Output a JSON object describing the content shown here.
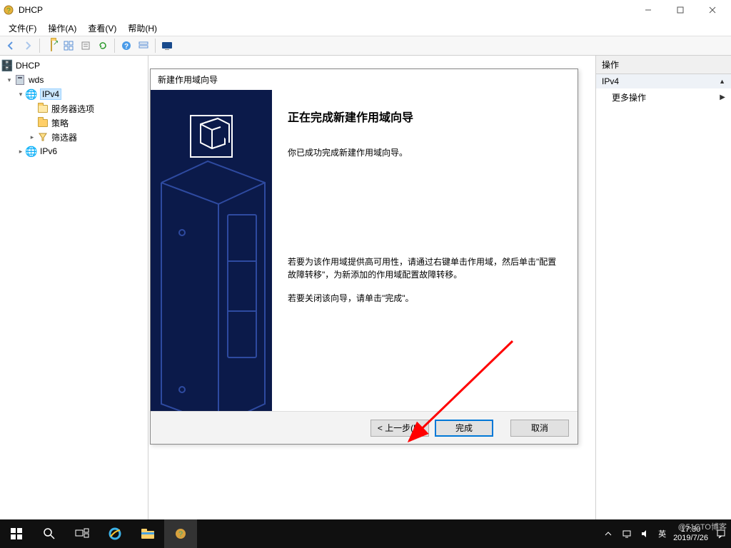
{
  "window": {
    "title": "DHCP"
  },
  "menu": {
    "file": "文件(F)",
    "action": "操作(A)",
    "view": "查看(V)",
    "help": "帮助(H)"
  },
  "tree": {
    "root": "DHCP",
    "server": "wds",
    "ipv4": "IPv4",
    "serverOptions": "服务器选项",
    "policies": "策略",
    "filters": "筛选器",
    "ipv6": "IPv6"
  },
  "actions": {
    "header": "操作",
    "sub": "IPv4",
    "more": "更多操作"
  },
  "dialog": {
    "title": "新建作用域向导",
    "heading": "正在完成新建作用域向导",
    "p1": "你已成功完成新建作用域向导。",
    "p2": "若要为该作用域提供高可用性，请通过右键单击作用域，然后单击\"配置故障转移\"，为新添加的作用域配置故障转移。",
    "p3": "若要关闭该向导，请单击\"完成\"。",
    "back": "< 上一步(B)",
    "finish": "完成",
    "cancel": "取消"
  },
  "tray": {
    "ime": "英",
    "time": "17:30",
    "date": "2019/7/26"
  },
  "watermark": "@51CTO博客"
}
